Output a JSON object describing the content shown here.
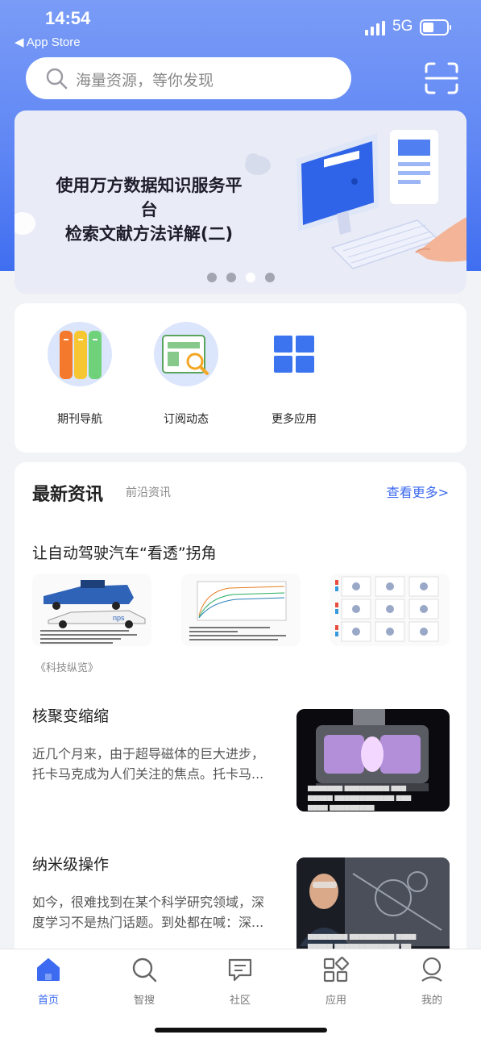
{
  "status_bar": {
    "time": "14:54",
    "back_app": "◀ App Store",
    "network": "5G"
  },
  "search": {
    "placeholder": "海量资源，等你发现",
    "scan_icon": "scan-icon"
  },
  "banner": {
    "title_line1": "使用万方数据知识服务平台",
    "title_line2": "检索文献方法详解(二)",
    "page_dots": 4,
    "active_dot": 3
  },
  "apps": [
    {
      "label": "期刊导航",
      "icon": "books-icon"
    },
    {
      "label": "订阅动态",
      "icon": "subscribe-search-icon"
    },
    {
      "label": "更多应用",
      "icon": "grid-apps-icon"
    }
  ],
  "news": {
    "heading": "最新资讯",
    "subheading": "前沿资讯",
    "more_link": "查看更多>",
    "featured": {
      "title": "让自动驾驶汽车“看透”拐角",
      "source": "《科技纵览》"
    },
    "articles": [
      {
        "title": "核聚变缩缩",
        "desc_line1": "近几个月来，由于超导磁体的巨大进步，",
        "desc_line2": "托卡马克成为人们关注的焦点。托卡马..."
      },
      {
        "title": "纳米级操作",
        "desc_line1": "如今，很难找到在某个科学研究领域，深",
        "desc_line2": "度学习不是热门话题。到处都在喊：深..."
      }
    ]
  },
  "tabbar": [
    {
      "label": "首页",
      "icon": "home-icon",
      "active": true
    },
    {
      "label": "智搜",
      "icon": "search-icon",
      "active": false
    },
    {
      "label": "社区",
      "icon": "chat-icon",
      "active": false
    },
    {
      "label": "应用",
      "icon": "apps-icon",
      "active": false
    },
    {
      "label": "我的",
      "icon": "profile-icon",
      "active": false
    }
  ],
  "colors": {
    "accent": "#3c6af0",
    "header_gradient_top": "#7a9cf7",
    "header_gradient_bottom": "#3f6ef0"
  }
}
